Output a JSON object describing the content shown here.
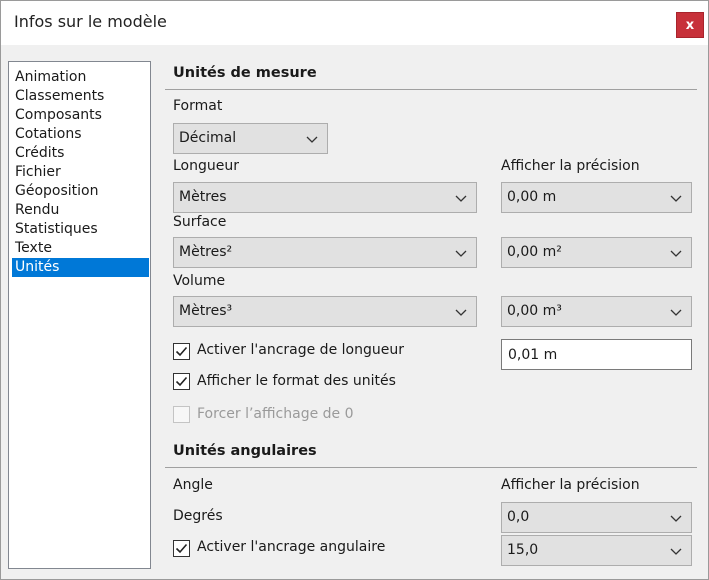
{
  "window": {
    "title": "Infos sur le modèle",
    "close_label": "x"
  },
  "sidebar": {
    "items": [
      {
        "label": "Animation",
        "selected": false
      },
      {
        "label": "Classements",
        "selected": false
      },
      {
        "label": "Composants",
        "selected": false
      },
      {
        "label": "Cotations",
        "selected": false
      },
      {
        "label": "Crédits",
        "selected": false
      },
      {
        "label": "Fichier",
        "selected": false
      },
      {
        "label": "Géoposition",
        "selected": false
      },
      {
        "label": "Rendu",
        "selected": false
      },
      {
        "label": "Statistiques",
        "selected": false
      },
      {
        "label": "Texte",
        "selected": false
      },
      {
        "label": "Unités",
        "selected": true
      }
    ]
  },
  "measure": {
    "title": "Unités de mesure",
    "format_label": "Format",
    "format_value": "Décimal",
    "length_label": "Longueur",
    "length_value": "Mètres",
    "precision_label": "Afficher la précision",
    "length_precision": "0,00 m",
    "surface_label": "Surface",
    "surface_value": "Mètres²",
    "surface_precision": "0,00 m²",
    "volume_label": "Volume",
    "volume_value": "Mètres³",
    "volume_precision": "0,00 m³",
    "snap_length_label": "Activer l'ancrage de longueur",
    "snap_length_checked": true,
    "snap_length_value": "0,01 m",
    "show_format_label": "Afficher le format des unités",
    "show_format_checked": true,
    "force_zero_label": "Forcer l’affichage de 0",
    "force_zero_checked": false
  },
  "angular": {
    "title": "Unités angulaires",
    "angle_label": "Angle",
    "precision_label": "Afficher la précision",
    "degrees_label": "Degrés",
    "precision_value": "0,0",
    "snap_label": "Activer l'ancrage angulaire",
    "snap_checked": true,
    "snap_value": "15,0"
  },
  "colors": {
    "selection": "#0078d7",
    "close_button": "#c7313a",
    "background": "#f0f0f0"
  }
}
